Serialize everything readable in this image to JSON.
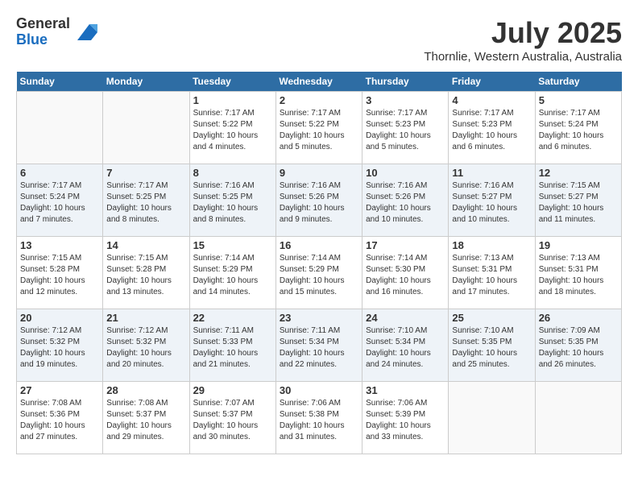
{
  "header": {
    "logo_general": "General",
    "logo_blue": "Blue",
    "title": "July 2025",
    "location": "Thornlie, Western Australia, Australia"
  },
  "days_of_week": [
    "Sunday",
    "Monday",
    "Tuesday",
    "Wednesday",
    "Thursday",
    "Friday",
    "Saturday"
  ],
  "weeks": [
    [
      {
        "day": "",
        "info": ""
      },
      {
        "day": "",
        "info": ""
      },
      {
        "day": "1",
        "info": "Sunrise: 7:17 AM\nSunset: 5:22 PM\nDaylight: 10 hours and 4 minutes."
      },
      {
        "day": "2",
        "info": "Sunrise: 7:17 AM\nSunset: 5:22 PM\nDaylight: 10 hours and 5 minutes."
      },
      {
        "day": "3",
        "info": "Sunrise: 7:17 AM\nSunset: 5:23 PM\nDaylight: 10 hours and 5 minutes."
      },
      {
        "day": "4",
        "info": "Sunrise: 7:17 AM\nSunset: 5:23 PM\nDaylight: 10 hours and 6 minutes."
      },
      {
        "day": "5",
        "info": "Sunrise: 7:17 AM\nSunset: 5:24 PM\nDaylight: 10 hours and 6 minutes."
      }
    ],
    [
      {
        "day": "6",
        "info": "Sunrise: 7:17 AM\nSunset: 5:24 PM\nDaylight: 10 hours and 7 minutes."
      },
      {
        "day": "7",
        "info": "Sunrise: 7:17 AM\nSunset: 5:25 PM\nDaylight: 10 hours and 8 minutes."
      },
      {
        "day": "8",
        "info": "Sunrise: 7:16 AM\nSunset: 5:25 PM\nDaylight: 10 hours and 8 minutes."
      },
      {
        "day": "9",
        "info": "Sunrise: 7:16 AM\nSunset: 5:26 PM\nDaylight: 10 hours and 9 minutes."
      },
      {
        "day": "10",
        "info": "Sunrise: 7:16 AM\nSunset: 5:26 PM\nDaylight: 10 hours and 10 minutes."
      },
      {
        "day": "11",
        "info": "Sunrise: 7:16 AM\nSunset: 5:27 PM\nDaylight: 10 hours and 10 minutes."
      },
      {
        "day": "12",
        "info": "Sunrise: 7:15 AM\nSunset: 5:27 PM\nDaylight: 10 hours and 11 minutes."
      }
    ],
    [
      {
        "day": "13",
        "info": "Sunrise: 7:15 AM\nSunset: 5:28 PM\nDaylight: 10 hours and 12 minutes."
      },
      {
        "day": "14",
        "info": "Sunrise: 7:15 AM\nSunset: 5:28 PM\nDaylight: 10 hours and 13 minutes."
      },
      {
        "day": "15",
        "info": "Sunrise: 7:14 AM\nSunset: 5:29 PM\nDaylight: 10 hours and 14 minutes."
      },
      {
        "day": "16",
        "info": "Sunrise: 7:14 AM\nSunset: 5:29 PM\nDaylight: 10 hours and 15 minutes."
      },
      {
        "day": "17",
        "info": "Sunrise: 7:14 AM\nSunset: 5:30 PM\nDaylight: 10 hours and 16 minutes."
      },
      {
        "day": "18",
        "info": "Sunrise: 7:13 AM\nSunset: 5:31 PM\nDaylight: 10 hours and 17 minutes."
      },
      {
        "day": "19",
        "info": "Sunrise: 7:13 AM\nSunset: 5:31 PM\nDaylight: 10 hours and 18 minutes."
      }
    ],
    [
      {
        "day": "20",
        "info": "Sunrise: 7:12 AM\nSunset: 5:32 PM\nDaylight: 10 hours and 19 minutes."
      },
      {
        "day": "21",
        "info": "Sunrise: 7:12 AM\nSunset: 5:32 PM\nDaylight: 10 hours and 20 minutes."
      },
      {
        "day": "22",
        "info": "Sunrise: 7:11 AM\nSunset: 5:33 PM\nDaylight: 10 hours and 21 minutes."
      },
      {
        "day": "23",
        "info": "Sunrise: 7:11 AM\nSunset: 5:34 PM\nDaylight: 10 hours and 22 minutes."
      },
      {
        "day": "24",
        "info": "Sunrise: 7:10 AM\nSunset: 5:34 PM\nDaylight: 10 hours and 24 minutes."
      },
      {
        "day": "25",
        "info": "Sunrise: 7:10 AM\nSunset: 5:35 PM\nDaylight: 10 hours and 25 minutes."
      },
      {
        "day": "26",
        "info": "Sunrise: 7:09 AM\nSunset: 5:35 PM\nDaylight: 10 hours and 26 minutes."
      }
    ],
    [
      {
        "day": "27",
        "info": "Sunrise: 7:08 AM\nSunset: 5:36 PM\nDaylight: 10 hours and 27 minutes."
      },
      {
        "day": "28",
        "info": "Sunrise: 7:08 AM\nSunset: 5:37 PM\nDaylight: 10 hours and 29 minutes."
      },
      {
        "day": "29",
        "info": "Sunrise: 7:07 AM\nSunset: 5:37 PM\nDaylight: 10 hours and 30 minutes."
      },
      {
        "day": "30",
        "info": "Sunrise: 7:06 AM\nSunset: 5:38 PM\nDaylight: 10 hours and 31 minutes."
      },
      {
        "day": "31",
        "info": "Sunrise: 7:06 AM\nSunset: 5:39 PM\nDaylight: 10 hours and 33 minutes."
      },
      {
        "day": "",
        "info": ""
      },
      {
        "day": "",
        "info": ""
      }
    ]
  ]
}
